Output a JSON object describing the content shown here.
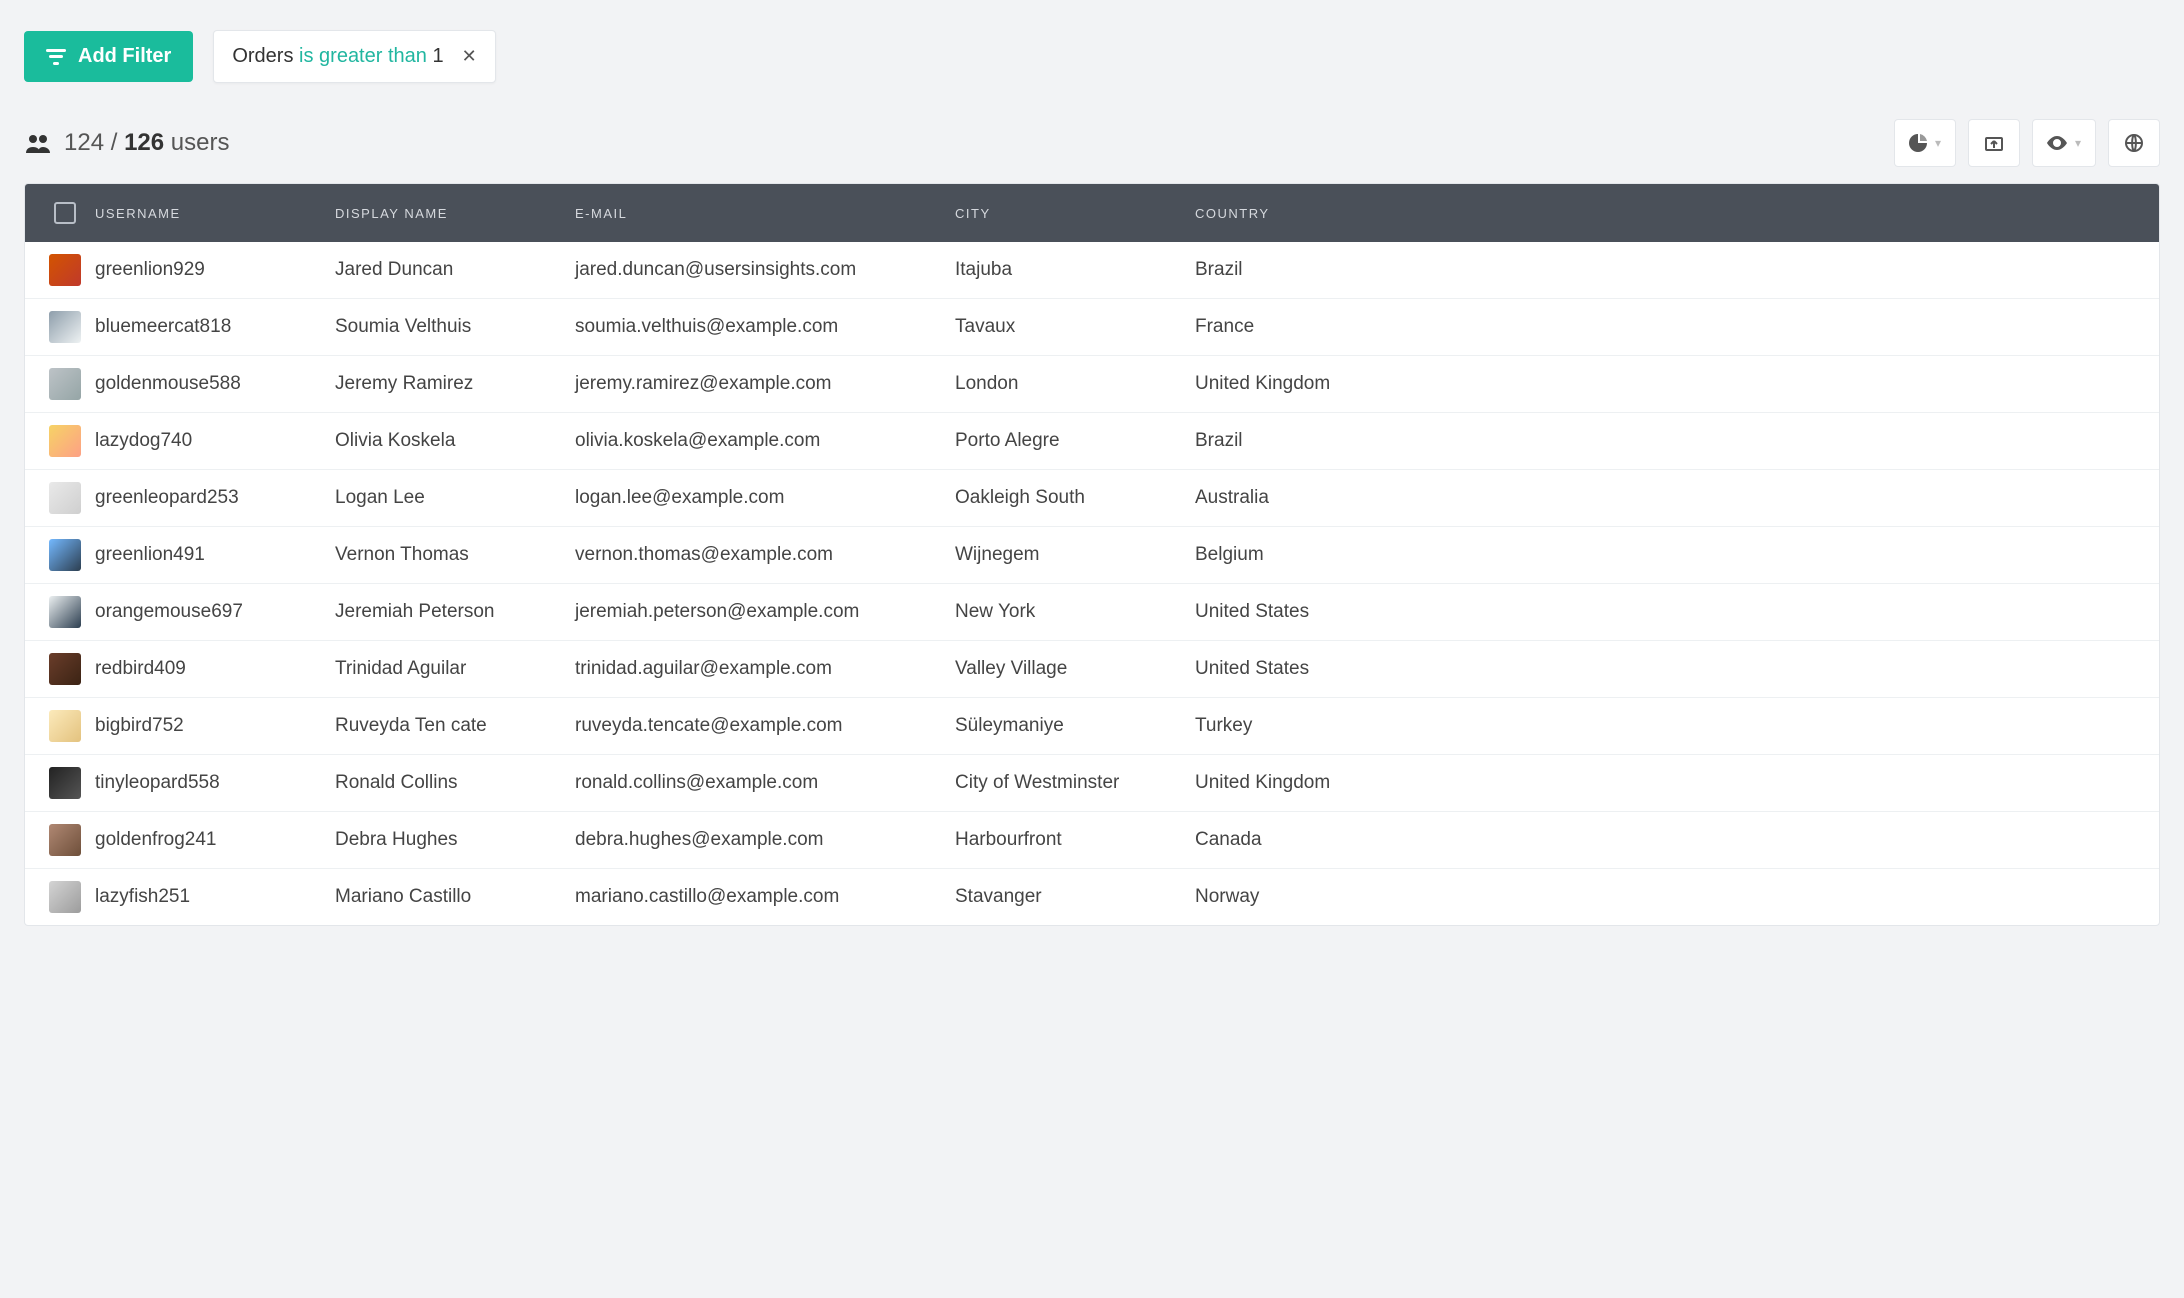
{
  "toolbar": {
    "add_filter_label": "Add Filter"
  },
  "filter_chip": {
    "field": "Orders",
    "operator": "is greater than",
    "value": "1"
  },
  "summary": {
    "filtered": "124",
    "separator": "/",
    "total": "126",
    "noun": "users"
  },
  "columns": {
    "username": "USERNAME",
    "display_name": "DISPLAY NAME",
    "email": "E-MAIL",
    "city": "CITY",
    "country": "COUNTRY"
  },
  "rows": [
    {
      "username": "greenlion929",
      "display_name": "Jared Duncan",
      "email": "jared.duncan@usersinsights.com",
      "city": "Itajuba",
      "country": "Brazil"
    },
    {
      "username": "bluemeercat818",
      "display_name": "Soumia Velthuis",
      "email": "soumia.velthuis@example.com",
      "city": "Tavaux",
      "country": "France"
    },
    {
      "username": "goldenmouse588",
      "display_name": "Jeremy Ramirez",
      "email": "jeremy.ramirez@example.com",
      "city": "London",
      "country": "United Kingdom"
    },
    {
      "username": "lazydog740",
      "display_name": "Olivia Koskela",
      "email": "olivia.koskela@example.com",
      "city": "Porto Alegre",
      "country": "Brazil"
    },
    {
      "username": "greenleopard253",
      "display_name": "Logan Lee",
      "email": "logan.lee@example.com",
      "city": "Oakleigh South",
      "country": "Australia"
    },
    {
      "username": "greenlion491",
      "display_name": "Vernon Thomas",
      "email": "vernon.thomas@example.com",
      "city": "Wijnegem",
      "country": "Belgium"
    },
    {
      "username": "orangemouse697",
      "display_name": "Jeremiah Peterson",
      "email": "jeremiah.peterson@example.com",
      "city": "New York",
      "country": "United States"
    },
    {
      "username": "redbird409",
      "display_name": "Trinidad Aguilar",
      "email": "trinidad.aguilar@example.com",
      "city": "Valley Village",
      "country": "United States"
    },
    {
      "username": "bigbird752",
      "display_name": "Ruveyda Ten cate",
      "email": "ruveyda.tencate@example.com",
      "city": "Süleymaniye",
      "country": "Turkey"
    },
    {
      "username": "tinyleopard558",
      "display_name": "Ronald Collins",
      "email": "ronald.collins@example.com",
      "city": "City of Westminster",
      "country": "United Kingdom"
    },
    {
      "username": "goldenfrog241",
      "display_name": "Debra Hughes",
      "email": "debra.hughes@example.com",
      "city": "Harbourfront",
      "country": "Canada"
    },
    {
      "username": "lazyfish251",
      "display_name": "Mariano Castillo",
      "email": "mariano.castillo@example.com",
      "city": "Stavanger",
      "country": "Norway"
    }
  ]
}
